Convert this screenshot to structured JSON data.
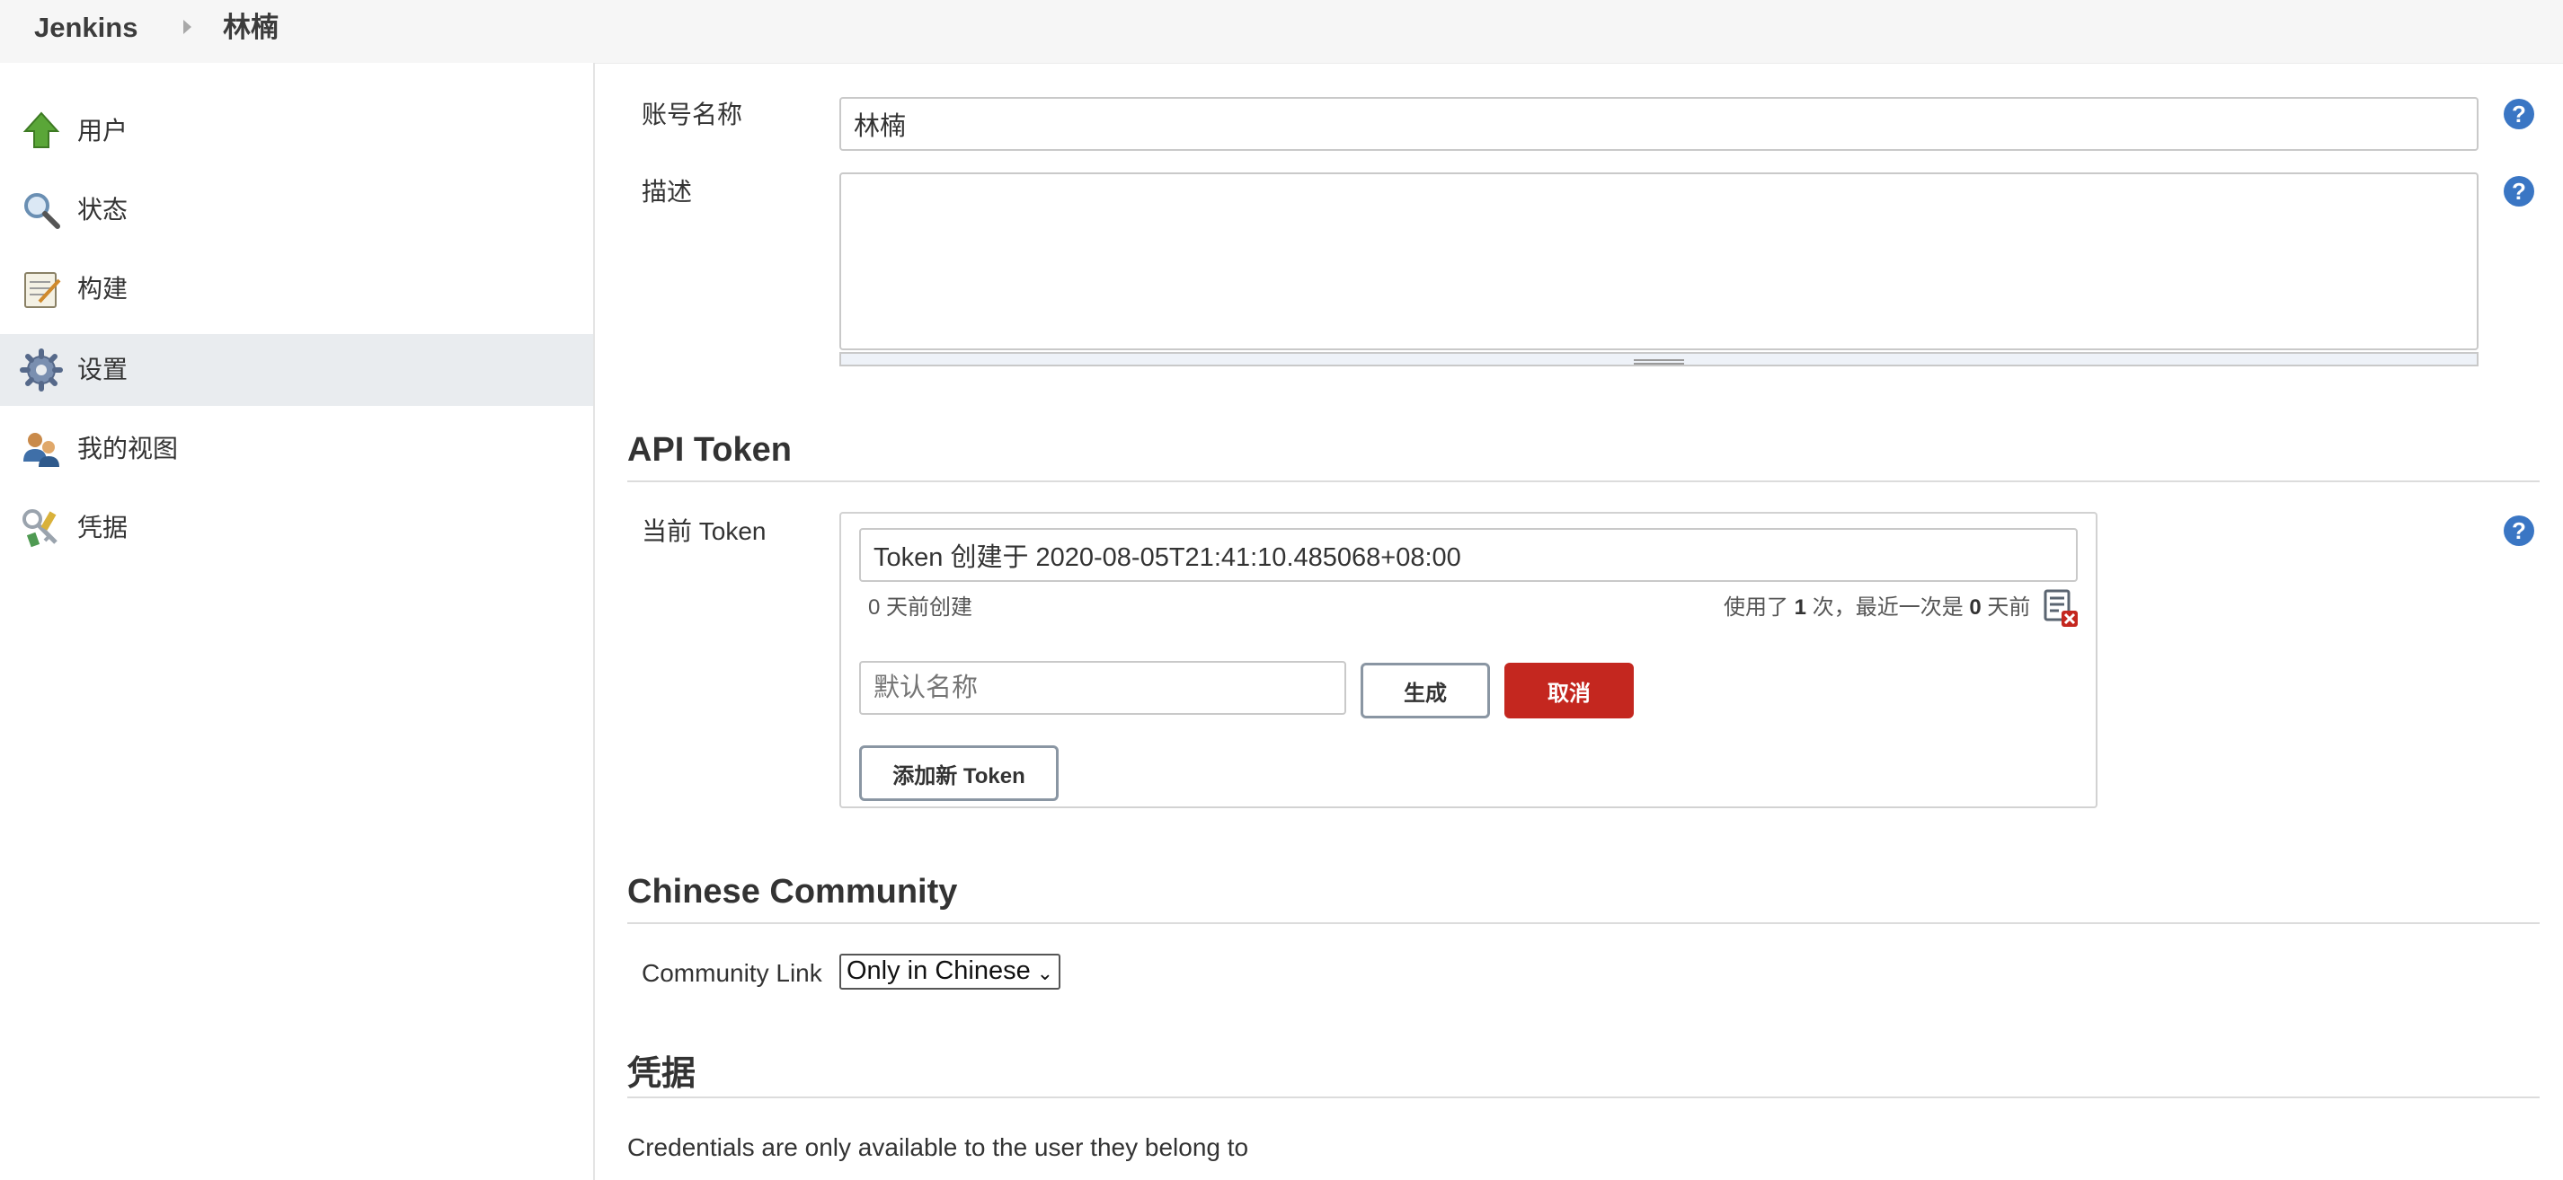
{
  "breadcrumb": {
    "root": "Jenkins",
    "user": "林楠"
  },
  "sidebar": {
    "items": [
      {
        "label": "用户",
        "icon": "user-up-arrow-icon"
      },
      {
        "label": "状态",
        "icon": "magnifier-icon"
      },
      {
        "label": "构建",
        "icon": "notepad-icon"
      },
      {
        "label": "设置",
        "icon": "gear-icon",
        "active": true
      },
      {
        "label": "我的视图",
        "icon": "people-icon"
      },
      {
        "label": "凭据",
        "icon": "keys-icon"
      }
    ]
  },
  "form": {
    "account_name_label": "账号名称",
    "account_name_value": "林楠",
    "description_label": "描述",
    "description_value": "",
    "help_glyph": "?"
  },
  "api_token": {
    "title": "API Token",
    "current_label": "当前 Token",
    "token_value": "Token 创建于 2020-08-05T21:41:10.485068+08:00",
    "created_text": "0 天前创建",
    "usage_prefix": "使用了 ",
    "usage_count": "1",
    "usage_middle": " 次，最近一次是 ",
    "usage_days": "0",
    "usage_suffix": " 天前",
    "name_placeholder": "默认名称",
    "generate_button": "生成",
    "cancel_button": "取消",
    "add_button": "添加新 Token"
  },
  "community": {
    "title": "Chinese Community",
    "link_label": "Community Link",
    "link_selected": "Only in Chinese"
  },
  "credentials": {
    "title": "凭据",
    "note": "Credentials are only available to the user they belong to"
  },
  "colors": {
    "accent": "#3a76c4",
    "danger": "#c4271f",
    "active_bg": "#e9ecef"
  }
}
